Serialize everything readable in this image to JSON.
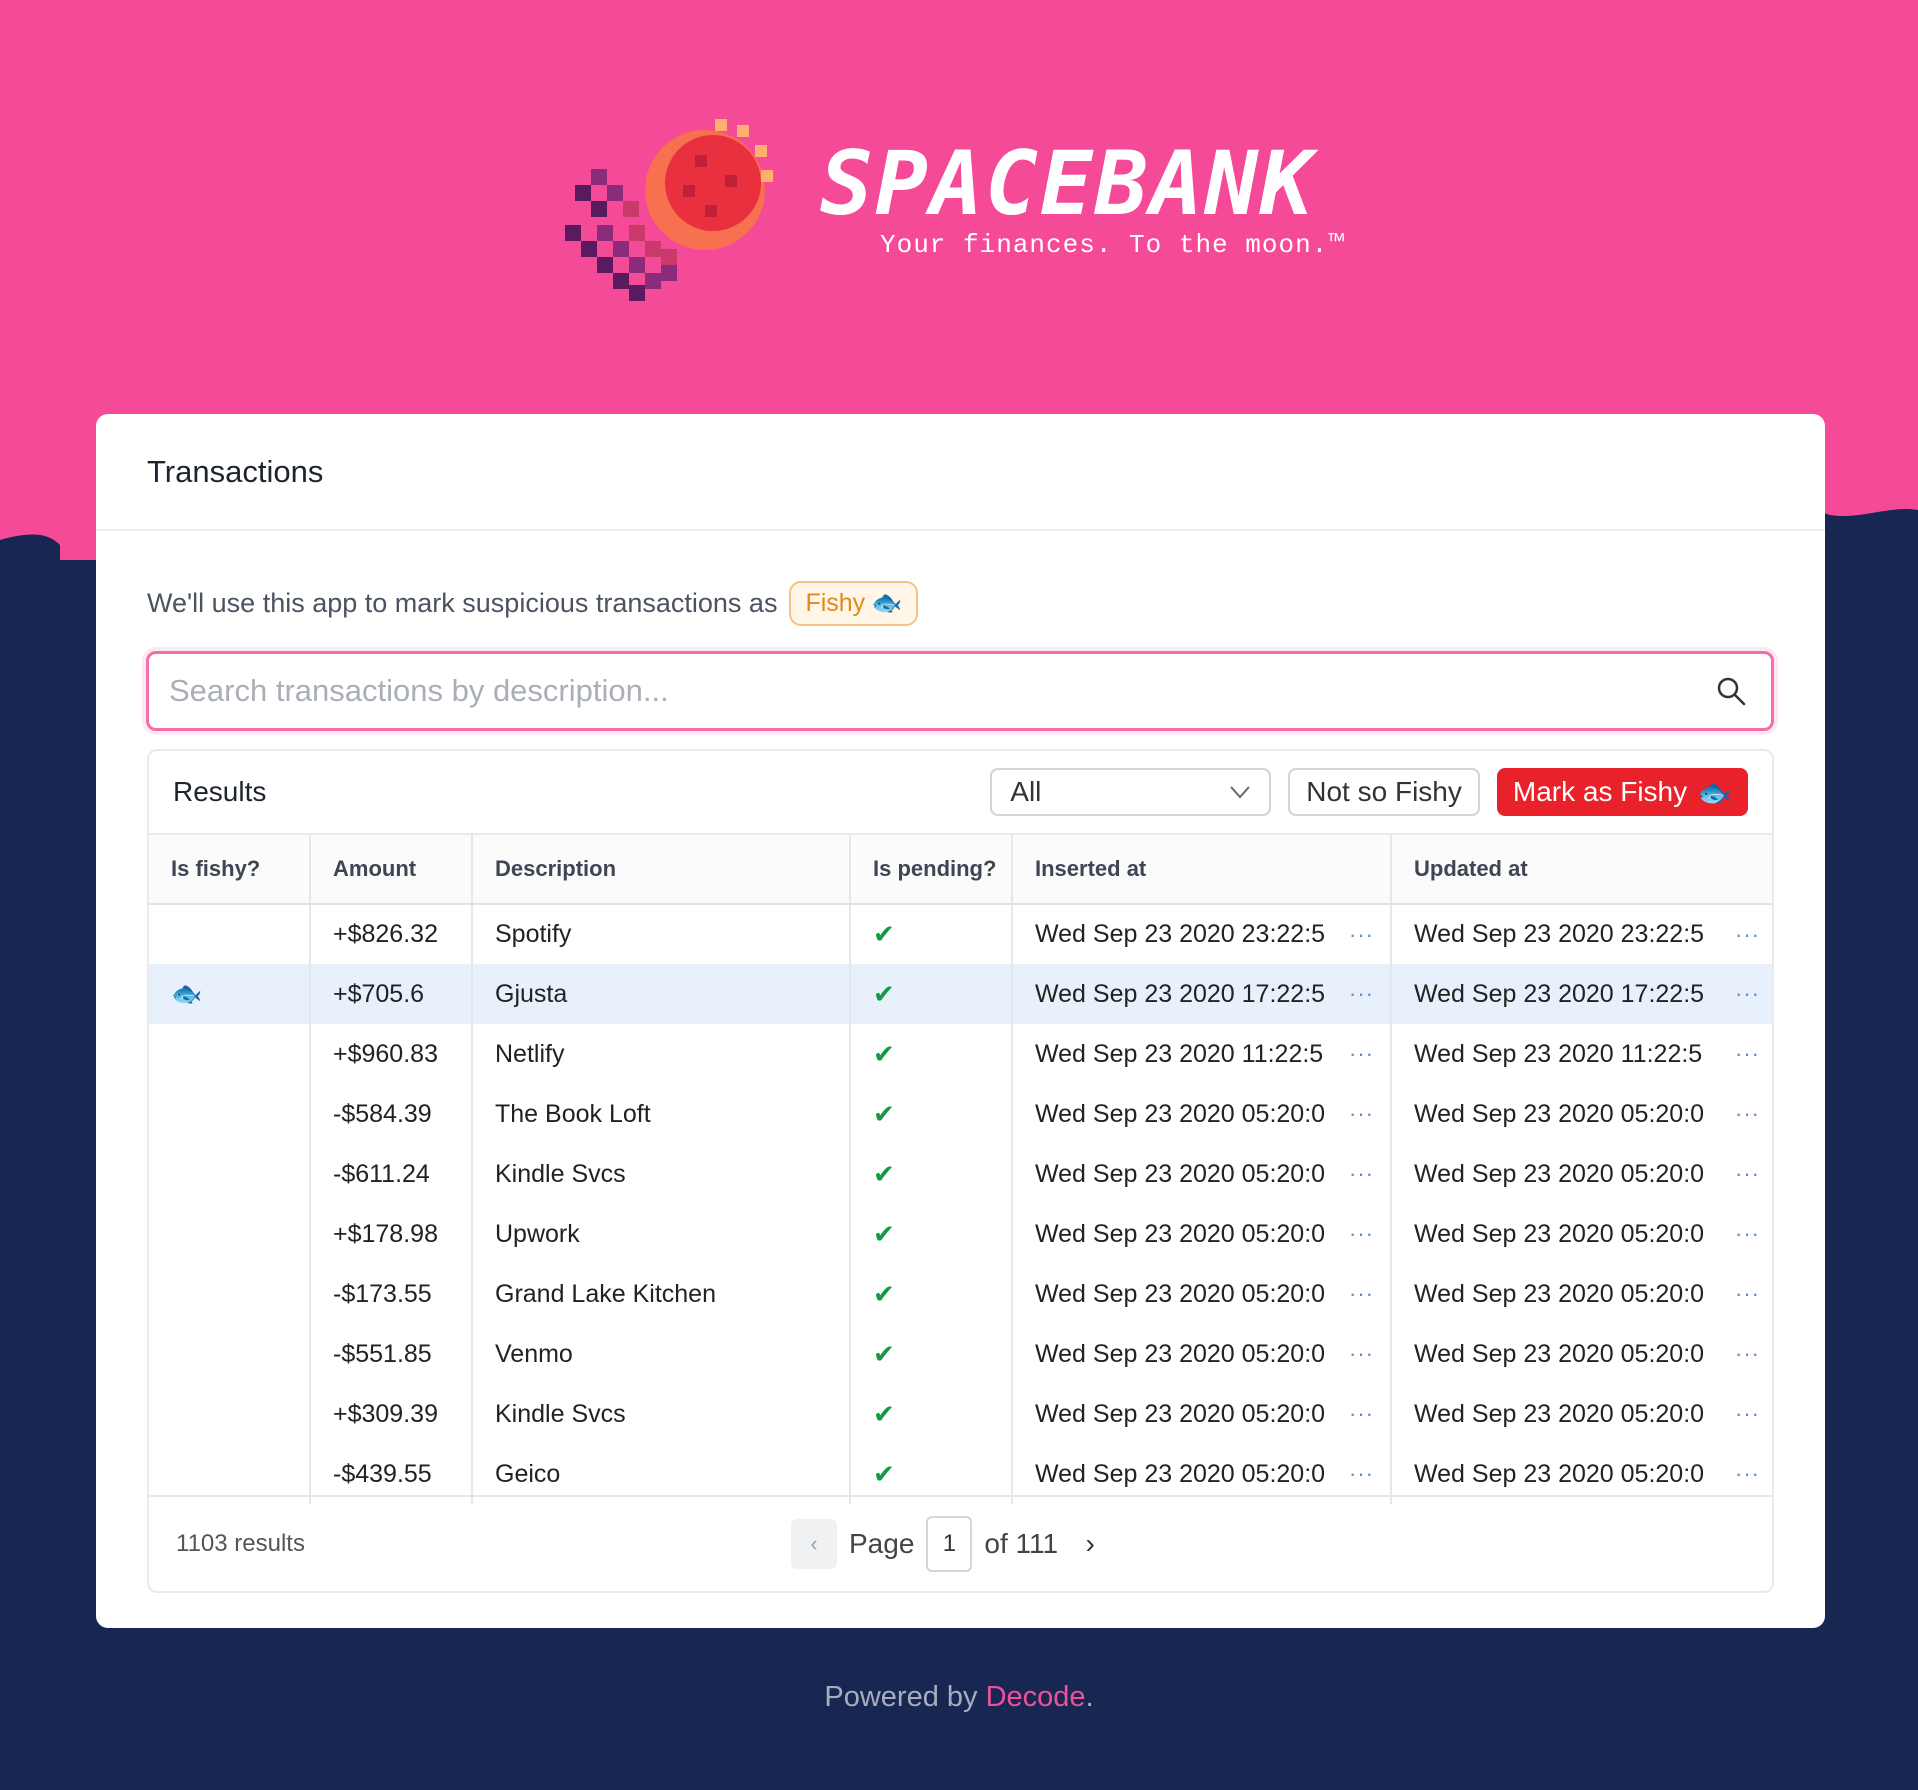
{
  "brand": {
    "name": "SPACEBANK",
    "tagline": "Your finances. To the moon.™"
  },
  "card": {
    "title": "Transactions",
    "intro_text": "We'll use this app to mark suspicious transactions as",
    "badge_label": "Fishy"
  },
  "search": {
    "placeholder": "Search transactions by description...",
    "value": ""
  },
  "results": {
    "title": "Results",
    "filter_value": "All",
    "not_fishy_label": "Not so Fishy",
    "mark_fishy_label": "Mark as Fishy"
  },
  "table": {
    "columns": [
      "Is fishy?",
      "Amount",
      "Description",
      "Is pending?",
      "Inserted at",
      "Updated at"
    ],
    "rows": [
      {
        "fishy": "",
        "amount": "+$826.32",
        "description": "Spotify",
        "pending": "✔",
        "inserted": "Wed Sep 23 2020 23:22:5",
        "updated": "Wed Sep 23 2020 23:22:5"
      },
      {
        "fishy": "🐟",
        "amount": "+$705.6",
        "description": "Gjusta",
        "pending": "✔",
        "inserted": "Wed Sep 23 2020 17:22:5",
        "updated": "Wed Sep 23 2020 17:22:5"
      },
      {
        "fishy": "",
        "amount": "+$960.83",
        "description": "Netlify",
        "pending": "✔",
        "inserted": "Wed Sep 23 2020 11:22:5",
        "updated": "Wed Sep 23 2020 11:22:5"
      },
      {
        "fishy": "",
        "amount": "-$584.39",
        "description": "The Book Loft",
        "pending": "✔",
        "inserted": "Wed Sep 23 2020 05:20:0",
        "updated": "Wed Sep 23 2020 05:20:0"
      },
      {
        "fishy": "",
        "amount": "-$611.24",
        "description": "Kindle Svcs",
        "pending": "✔",
        "inserted": "Wed Sep 23 2020 05:20:0",
        "updated": "Wed Sep 23 2020 05:20:0"
      },
      {
        "fishy": "",
        "amount": "+$178.98",
        "description": "Upwork",
        "pending": "✔",
        "inserted": "Wed Sep 23 2020 05:20:0",
        "updated": "Wed Sep 23 2020 05:20:0"
      },
      {
        "fishy": "",
        "amount": "-$173.55",
        "description": "Grand Lake Kitchen",
        "pending": "✔",
        "inserted": "Wed Sep 23 2020 05:20:0",
        "updated": "Wed Sep 23 2020 05:20:0"
      },
      {
        "fishy": "",
        "amount": "-$551.85",
        "description": "Venmo",
        "pending": "✔",
        "inserted": "Wed Sep 23 2020 05:20:0",
        "updated": "Wed Sep 23 2020 05:20:0"
      },
      {
        "fishy": "",
        "amount": "+$309.39",
        "description": "Kindle Svcs",
        "pending": "✔",
        "inserted": "Wed Sep 23 2020 05:20:0",
        "updated": "Wed Sep 23 2020 05:20:0"
      },
      {
        "fishy": "",
        "amount": "-$439.55",
        "description": "Geico",
        "pending": "✔",
        "inserted": "Wed Sep 23 2020 05:20:0",
        "updated": "Wed Sep 23 2020 05:20:0"
      }
    ],
    "selected_row": 1,
    "more_glyph": "···"
  },
  "pagination": {
    "count_label": "1103 results",
    "page_label": "Page",
    "current_page": "1",
    "of_label": "of 111"
  },
  "footer": {
    "prefix": "Powered by",
    "link": "Decode",
    "suffix": "."
  },
  "colors": {
    "pink": "#f54a98",
    "navy": "#172751",
    "accent_red": "#e8212b",
    "check_green": "#139a45"
  },
  "icons": {
    "search": "search-icon",
    "chevron": "chevron-down-icon",
    "fish": "fish-icon",
    "prev": "chevron-left-icon",
    "next": "chevron-right-icon"
  }
}
